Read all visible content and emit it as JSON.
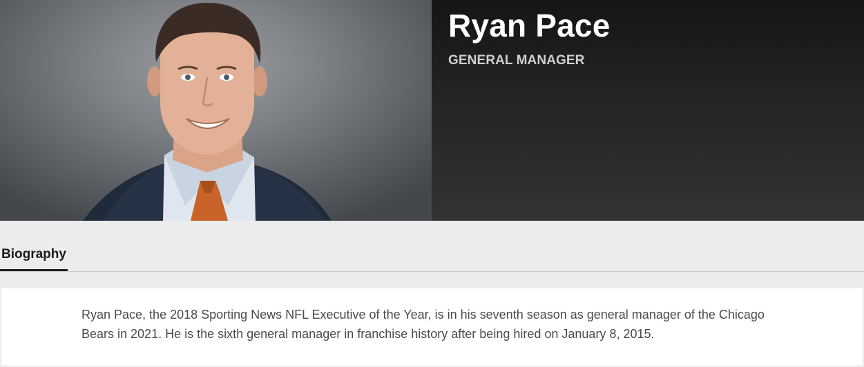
{
  "profile": {
    "name": "Ryan Pace",
    "role": "GENERAL MANAGER"
  },
  "tabs": [
    {
      "label": "Biography",
      "active": true
    }
  ],
  "biography": {
    "text": "Ryan Pace, the 2018 Sporting News NFL Executive of the Year, is in his seventh season as general manager of the Chicago Bears in 2021. He is the sixth general manager in franchise history after being hired on January 8, 2015."
  },
  "colors": {
    "page_background": "#ececec",
    "hero_panel": "#242424",
    "name_text": "#ffffff",
    "role_text": "#cfcfcf",
    "bio_text": "#4a4a4a"
  }
}
